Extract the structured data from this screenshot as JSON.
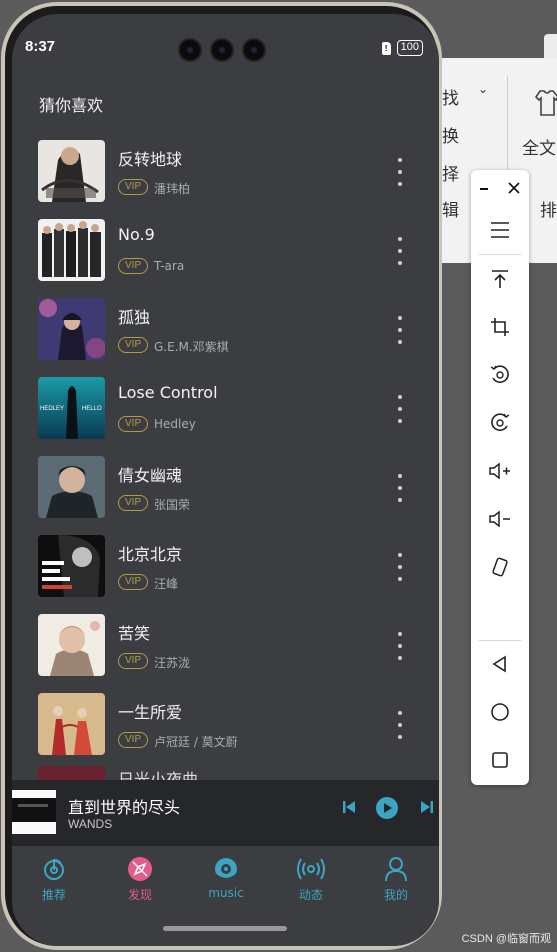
{
  "status": {
    "time": "8:37",
    "sim_label": "!",
    "battery": "100"
  },
  "section_title": "猜你喜欢",
  "songs": [
    {
      "title": "反转地球",
      "vip": "VIP",
      "artist": "潘玮柏"
    },
    {
      "title": "No.9",
      "vip": "VIP",
      "artist": "T-ara"
    },
    {
      "title": "孤独",
      "vip": "VIP",
      "artist": "G.E.M.邓紫棋"
    },
    {
      "title": "Lose Control",
      "vip": "VIP",
      "artist": "Hedley"
    },
    {
      "title": "倩女幽魂",
      "vip": "VIP",
      "artist": "张国荣"
    },
    {
      "title": "北京北京",
      "vip": "VIP",
      "artist": "汪峰"
    },
    {
      "title": "苦笑",
      "vip": "VIP",
      "artist": "汪苏泷"
    },
    {
      "title": "一生所爱",
      "vip": "VIP",
      "artist": "卢冠廷 / 莫文蔚"
    }
  ],
  "partial_song_title": "日光小夜曲",
  "cover_texts": {
    "hedley_left": "HEDLEY",
    "hedley_right": "HELLO"
  },
  "player": {
    "title": "直到世界的尽头",
    "artist": "WANDS"
  },
  "tabs": [
    {
      "label": "推荐",
      "icon": "recommend-icon"
    },
    {
      "label": "发现",
      "icon": "discover-icon",
      "active": true
    },
    {
      "label": "music",
      "icon": "music-icon"
    },
    {
      "label": "动态",
      "icon": "broadcast-icon"
    },
    {
      "label": "我的",
      "icon": "profile-icon"
    }
  ],
  "background_app": {
    "items": [
      "找",
      "换",
      "择",
      "辑",
      "全文",
      "排"
    ]
  },
  "watermark": "CSDN @临窗而观",
  "colors": {
    "accent": "#3ca5c5",
    "active_tab": "#e35c8a",
    "vip": "#b39a4b",
    "screen_bg": "#3b3d40"
  }
}
